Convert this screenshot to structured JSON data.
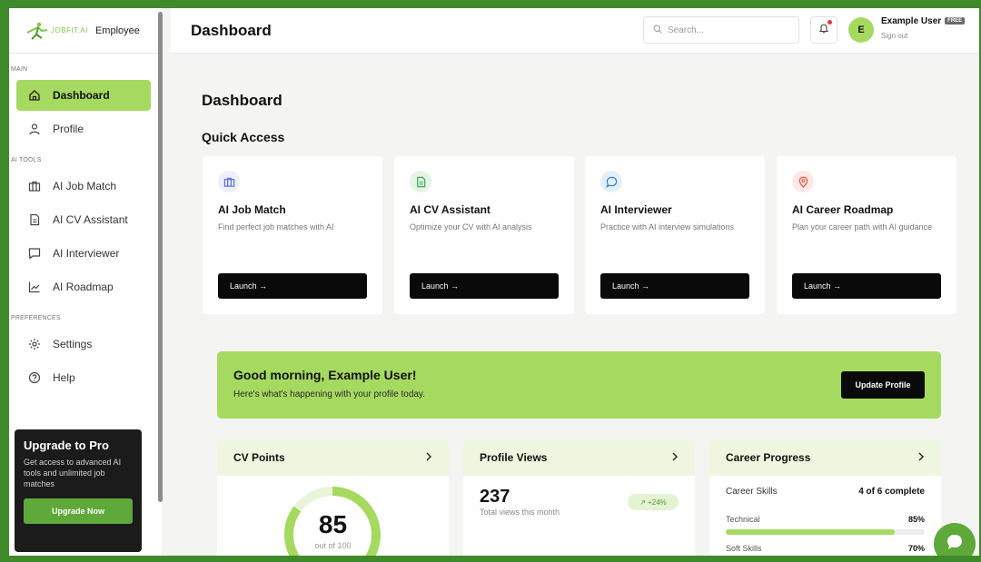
{
  "sidebar": {
    "brand_text": "JOBFIT.AI",
    "brand_sub": "Employee",
    "section_main": "MAIN",
    "section_tools": "AI TOOLS",
    "section_prefs": "PREFERENCES",
    "items": [
      {
        "label": "Dashboard",
        "icon": "home-icon"
      },
      {
        "label": "Profile",
        "icon": "user-icon"
      },
      {
        "label": "AI Job Match",
        "icon": "briefcase-icon"
      },
      {
        "label": "AI CV Assistant",
        "icon": "document-icon"
      },
      {
        "label": "AI Interviewer",
        "icon": "chat-icon"
      },
      {
        "label": "AI Roadmap",
        "icon": "chart-icon"
      },
      {
        "label": "Settings",
        "icon": "gear-icon"
      },
      {
        "label": "Help",
        "icon": "help-icon"
      }
    ],
    "upgrade": {
      "title": "Upgrade to Pro",
      "text": "Get access to advanced AI tools and unlimited job matches",
      "button": "Upgrade Now"
    }
  },
  "header": {
    "title": "Dashboard",
    "search_placeholder": "Search...",
    "avatar_initial": "E",
    "user_name": "Example User",
    "plan": "FREE",
    "sign_out": "Sign out"
  },
  "main": {
    "heading": "Dashboard",
    "quick_access": "Quick Access",
    "cards": [
      {
        "title": "AI Job Match",
        "desc": "Find perfect job matches with AI",
        "button": "Launch →",
        "icon": "briefcase-icon",
        "icon_bg": "#eef0fb",
        "icon_color": "#5b6ee1"
      },
      {
        "title": "AI CV Assistant",
        "desc": "Optimize your CV with AI analysis",
        "button": "Launch →",
        "icon": "document-icon",
        "icon_bg": "#e4f5e6",
        "icon_color": "#3aa655"
      },
      {
        "title": "AI Interviewer",
        "desc": "Practice with AI interview simulations",
        "button": "Launch →",
        "icon": "chat-icon",
        "icon_bg": "#e3f0fb",
        "icon_color": "#2f7bd8"
      },
      {
        "title": "AI Career Roadmap",
        "desc": "Plan your career path with AI guidance",
        "button": "Launch →",
        "icon": "location-icon",
        "icon_bg": "#fbe9e7",
        "icon_color": "#e5533c"
      }
    ],
    "banner": {
      "title": "Good morning, Example User!",
      "subtitle": "Here's what's happening with your profile today.",
      "button": "Update Profile"
    },
    "stats": {
      "cv_points": {
        "title": "CV Points",
        "value": "85",
        "value_number": 85,
        "caption": "out of 100"
      },
      "profile_views": {
        "title": "Profile Views",
        "value": "237",
        "caption": "Total views this month",
        "trend": "↗ +24%"
      },
      "career_progress": {
        "title": "Career Progress",
        "skills_label": "Career Skills",
        "skills_status": "4 of 6 complete",
        "bars": [
          {
            "label": "Technical",
            "value": "85%",
            "fraction": 0.85
          },
          {
            "label": "Soft Skills",
            "value": "70%",
            "fraction": 0.7
          }
        ]
      }
    }
  },
  "colors": {
    "accent": "#a6d95f",
    "accent_dark": "#5fa83a",
    "frame": "#3f8a2a"
  }
}
